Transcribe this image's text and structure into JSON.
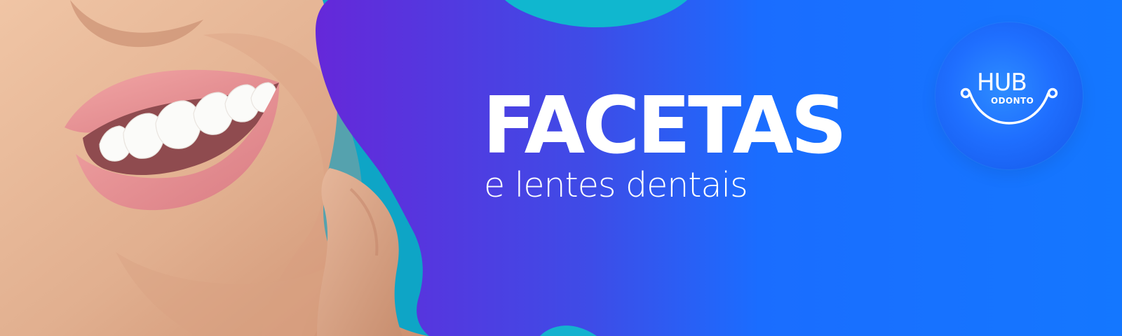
{
  "banner": {
    "headline": "FACETAS",
    "subtitle": "e lentes dentais"
  },
  "logo": {
    "line1": "HUB",
    "line2": "ODONTO"
  },
  "colors": {
    "background_teal": "#0ea5c6",
    "blob_purple": "#6230d8",
    "blob_blue": "#1170ff",
    "text": "#ffffff",
    "logo_blue": "#1f6fff",
    "skin": "#e6b392",
    "lips": "#e98f95"
  },
  "icons": {
    "brand_mark": "smile-icon"
  }
}
